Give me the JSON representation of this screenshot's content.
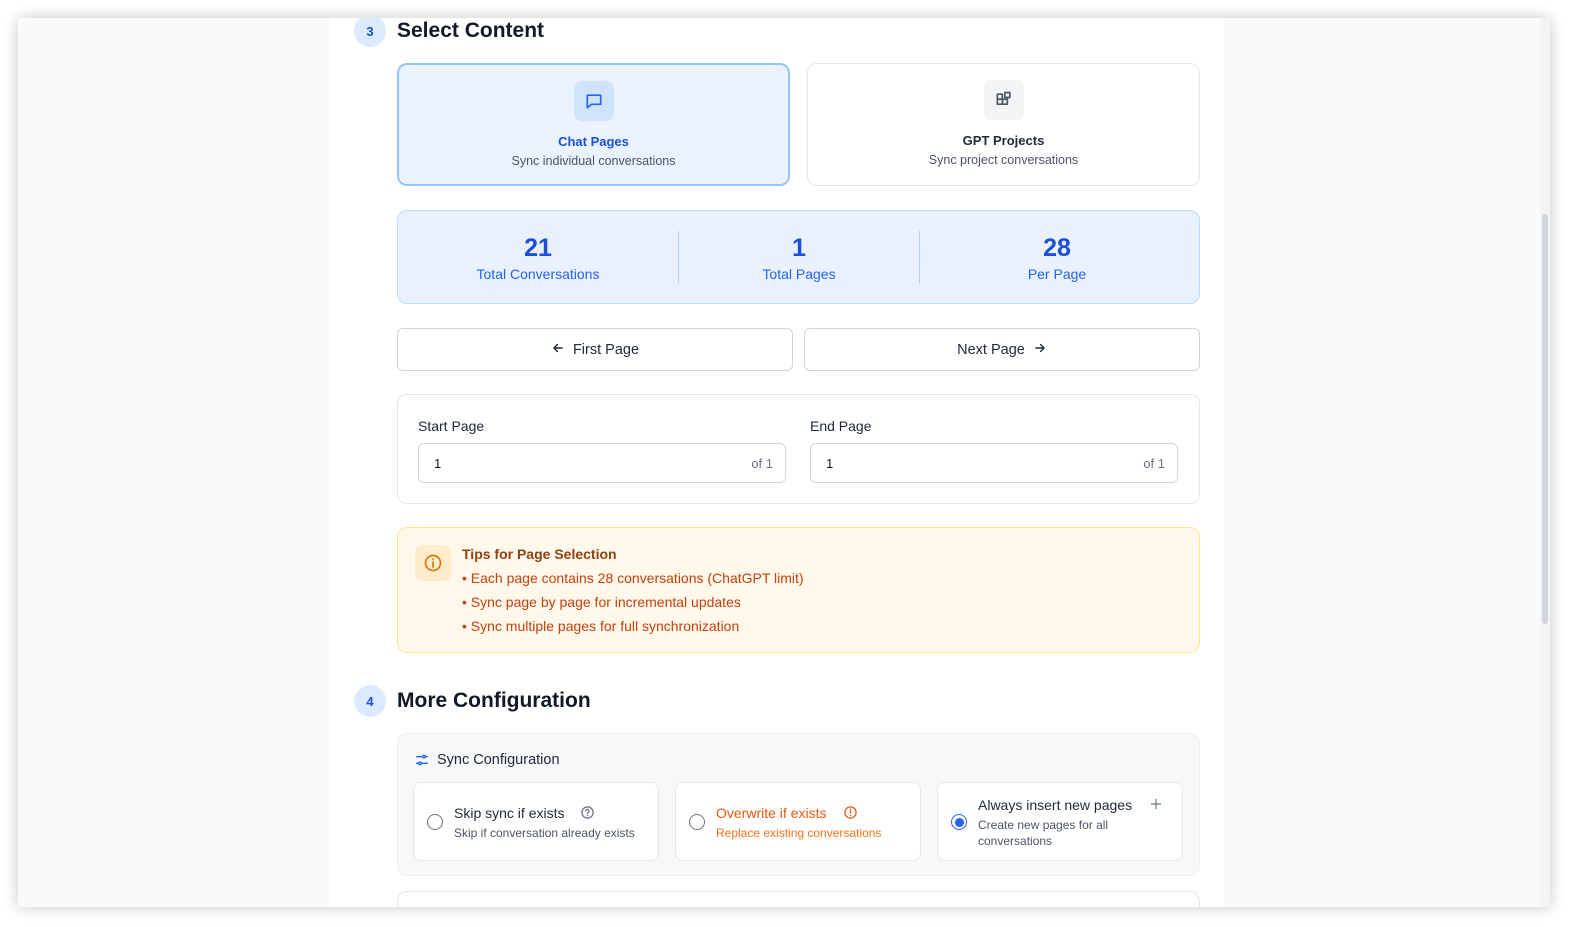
{
  "section3": {
    "number": "3",
    "title": "Select Content",
    "cards": [
      {
        "title": "Chat Pages",
        "desc": "Sync individual conversations",
        "icon": "chat-bubble-icon",
        "selected": true
      },
      {
        "title": "GPT Projects",
        "desc": "Sync project conversations",
        "icon": "grid-icon",
        "selected": false
      }
    ],
    "stats": [
      {
        "value": "21",
        "label": "Total Conversations"
      },
      {
        "value": "1",
        "label": "Total Pages"
      },
      {
        "value": "28",
        "label": "Per Page"
      }
    ],
    "nav": {
      "first": "First Page",
      "next": "Next Page"
    },
    "range": {
      "start_label": "Start Page",
      "start_value": "1",
      "start_suffix": "of 1",
      "end_label": "End Page",
      "end_value": "1",
      "end_suffix": "of 1"
    },
    "tips": {
      "title": "Tips for Page Selection",
      "items": [
        "• Each page contains 28 conversations (ChatGPT limit)",
        "• Sync page by page for incremental updates",
        "• Sync multiple pages for full synchronization"
      ]
    }
  },
  "section4": {
    "number": "4",
    "title": "More Configuration",
    "sync_title": "Sync Configuration",
    "options": [
      {
        "title": "Skip sync if exists",
        "desc": "Skip if conversation already exists",
        "selected": false
      },
      {
        "title": "Overwrite if exists",
        "desc": "Replace existing conversations",
        "selected": false
      },
      {
        "title": "Always insert new pages",
        "desc_line1": "Create new pages for all",
        "desc_line2": "conversations",
        "selected": true
      }
    ]
  },
  "colors": {
    "accent": "#2563eb",
    "warning": "#ea580c",
    "tips_bg": "#fff8eb"
  }
}
